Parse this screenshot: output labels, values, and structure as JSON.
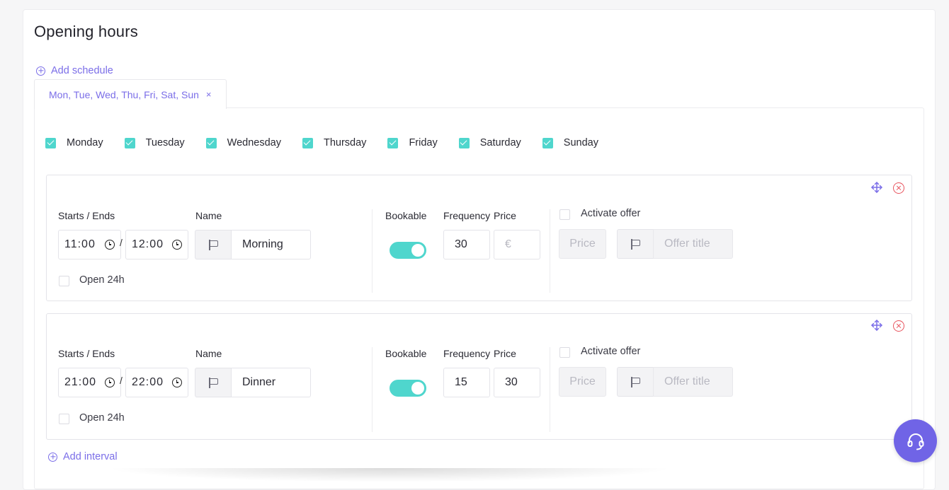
{
  "page": {
    "title": "Opening hours",
    "add_schedule_label": "Add schedule",
    "add_interval_label": "Add interval"
  },
  "colors": {
    "accent": "#7b6ee8",
    "teal": "#4fd6cd",
    "danger": "#e8545e",
    "fab": "#7064e6"
  },
  "schedule_tab": {
    "label": "Mon, Tue, Wed, Thu, Fri, Sat, Sun",
    "close_glyph": "×"
  },
  "days": [
    {
      "label": "Monday",
      "checked": true
    },
    {
      "label": "Tuesday",
      "checked": true
    },
    {
      "label": "Wednesday",
      "checked": true
    },
    {
      "label": "Thursday",
      "checked": true
    },
    {
      "label": "Friday",
      "checked": true
    },
    {
      "label": "Saturday",
      "checked": true
    },
    {
      "label": "Sunday",
      "checked": true
    }
  ],
  "labels": {
    "starts_ends": "Starts / Ends",
    "name": "Name",
    "bookable": "Bookable",
    "frequency": "Frequency",
    "price": "Price",
    "open_24h": "Open 24h",
    "activate_offer": "Activate offer",
    "offer_price_placeholder": "Price",
    "offer_title_placeholder": "Offer title",
    "time_separator": "/"
  },
  "intervals": [
    {
      "start": "11:00",
      "end": "12:00",
      "name": "Morning",
      "open_24h": false,
      "bookable": true,
      "frequency": "30",
      "price": "",
      "price_placeholder": "€",
      "activate_offer": false
    },
    {
      "start": "21:00",
      "end": "22:00",
      "name": "Dinner",
      "open_24h": false,
      "bookable": true,
      "frequency": "15",
      "price": "30",
      "price_placeholder": "€",
      "activate_offer": false
    }
  ],
  "icons": {
    "add": "circle-plus-icon",
    "move": "move-arrows-icon",
    "remove": "close-circle-icon",
    "clock": "clock-icon",
    "flag": "flag-icon",
    "support": "headset-icon"
  }
}
